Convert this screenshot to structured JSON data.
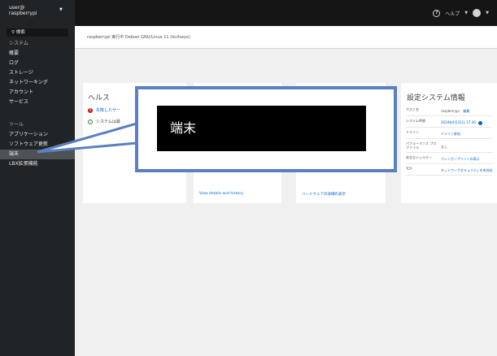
{
  "header": {
    "user": "user@",
    "hostname": "raspberrypi",
    "help_label": "ヘルプ"
  },
  "sidebar": {
    "search_label": "検索",
    "items": [
      {
        "label": "システム"
      },
      {
        "label": "概要"
      },
      {
        "label": "ログ"
      },
      {
        "label": "ストレージ"
      },
      {
        "label": "ネットワーキング"
      },
      {
        "label": "アカウント"
      },
      {
        "label": "サービス"
      },
      {
        "label": "ツール"
      },
      {
        "label": "アプリケーション"
      },
      {
        "label": "ソフトウェア更新"
      },
      {
        "label": "端末"
      },
      {
        "label": "LBX拡張機能"
      }
    ]
  },
  "main": {
    "status_line": "raspberrypi 実行中 Debian GNU/Linux 11 (bullseye)"
  },
  "health": {
    "title": "ヘルス",
    "error_text": "失敗したサー",
    "ok_text": "システムは最"
  },
  "usage": {
    "link": "View details and history"
  },
  "hardware": {
    "link": "ハードウェアの詳細の表示"
  },
  "config": {
    "title": "設定システム情報",
    "rows": [
      {
        "label": "ホスト名",
        "value": "raspberrypi",
        "action": "編集"
      },
      {
        "label": "システム時間",
        "value": "2024年4月22日 17:36"
      },
      {
        "label": "ドメイン",
        "value": "ドメイン参加"
      },
      {
        "label": "パフォーマンス プロファイル",
        "value": "なし"
      },
      {
        "label": "安全なシェルキー",
        "value": "フィンガープリントの表示"
      },
      {
        "label": "TCP",
        "value": "ネットワークセキュリティを有効化"
      }
    ]
  },
  "callout": {
    "text": "端末"
  }
}
